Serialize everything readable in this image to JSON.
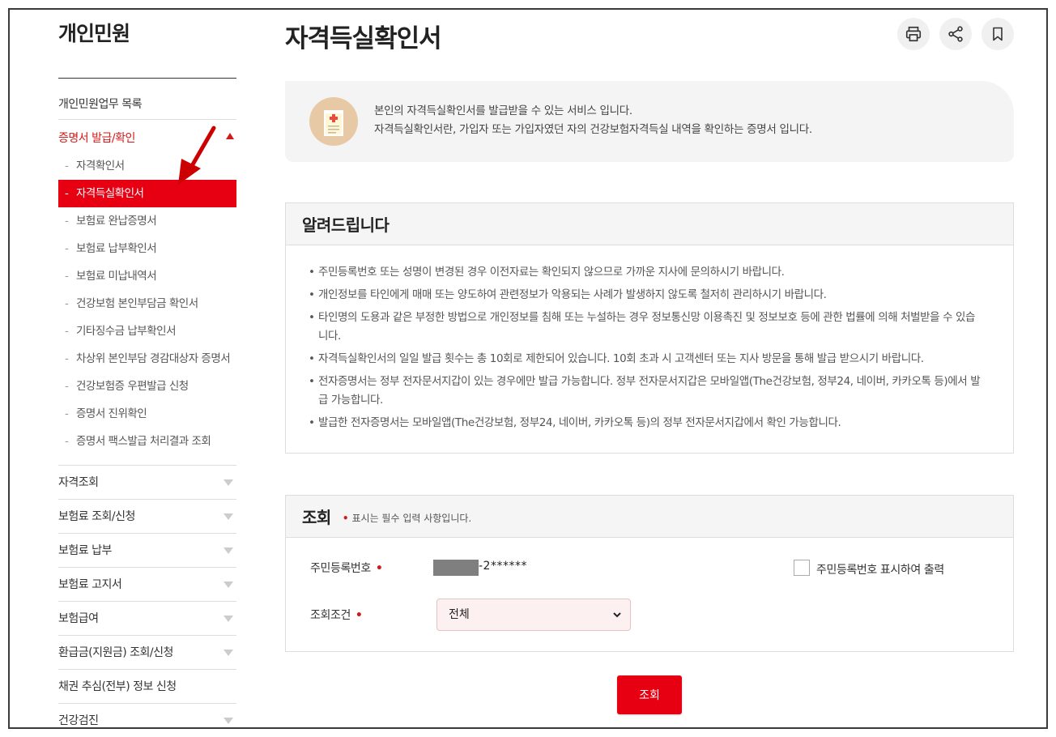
{
  "sidebar": {
    "title": "개인민원",
    "top_item": "개인민원업무 목록",
    "open_section": "증명서 발급/확인",
    "sub_items": [
      "자격확인서",
      "자격득실확인서",
      "보험료 완납증명서",
      "보험료 납부확인서",
      "보험료 미납내역서",
      "건강보험 본인부담금 확인서",
      "기타징수금 납부확인서",
      "차상위 본인부담 경감대상자 증명서",
      "건강보험증 우편발급 신청",
      "증명서 진위확인",
      "증명서 팩스발급 처리결과 조회"
    ],
    "active_sub_index": 1,
    "categories": [
      "자격조회",
      "보험료 조회/신청",
      "보험료 납부",
      "보험료 고지서",
      "보험급여",
      "환급금(지원금) 조회/신청",
      "채권 추심(전부) 정보 신청",
      "건강검진"
    ]
  },
  "header": {
    "title": "자격득실확인서",
    "icons": [
      "print-icon",
      "share-icon",
      "bookmark-icon"
    ]
  },
  "intro": {
    "line1": "본인의 자격득실확인서를 발급받을 수 있는 서비스 입니다.",
    "line2": "자격득실확인서란, 가입자 또는 가입자였던 자의 건강보험자격득실 내역을 확인하는 증명서 입니다."
  },
  "notice": {
    "title": "알려드립니다",
    "items": [
      "주민등록번호 또는 성명이 변경된 경우 이전자료는 확인되지 않으므로 가까운 지사에 문의하시기 바랍니다.",
      "개인정보를 타인에게 매매 또는 양도하여 관련정보가 악용되는 사례가 발생하지 않도록 철저히 관리하시기 바랍니다.",
      "타인명의 도용과 같은 부정한 방법으로 개인정보를 침해 또는 누설하는 경우 정보통신망 이용촉진 및 정보보호 등에 관한 법률에 의해 처벌받을 수 있습니다.",
      "자격득실확인서의 일일 발급 횟수는 총 10회로 제한되어 있습니다. 10회 초과 시 고객센터 또는 지사 방문을 통해 발급 받으시기 바랍니다.",
      "전자증명서는 정부 전자문서지갑이 있는 경우에만 발급 가능합니다. 정부 전자문서지갑은 모바일앱(The건강보험, 정부24, 네이버, 카카오톡 등)에서 발급 가능합니다.",
      "발급한 전자증명서는 모바일앱(The건강보험, 정부24, 네이버, 카카오톡 등)의 정부 전자문서지갑에서 확인 가능합니다."
    ]
  },
  "query": {
    "title": "조회",
    "required_note": "표시는 필수 입력 사항입니다.",
    "id_label": "주민등록번호",
    "id_suffix": "-2******",
    "show_id_label": "주민등록번호 표시하여 출력",
    "condition_label": "조회조건",
    "condition_value": "전체",
    "submit_label": "조회"
  },
  "colors": {
    "accent": "#e60012",
    "active_text": "#d11a1a",
    "annotation_arrow": "#cc0000"
  }
}
